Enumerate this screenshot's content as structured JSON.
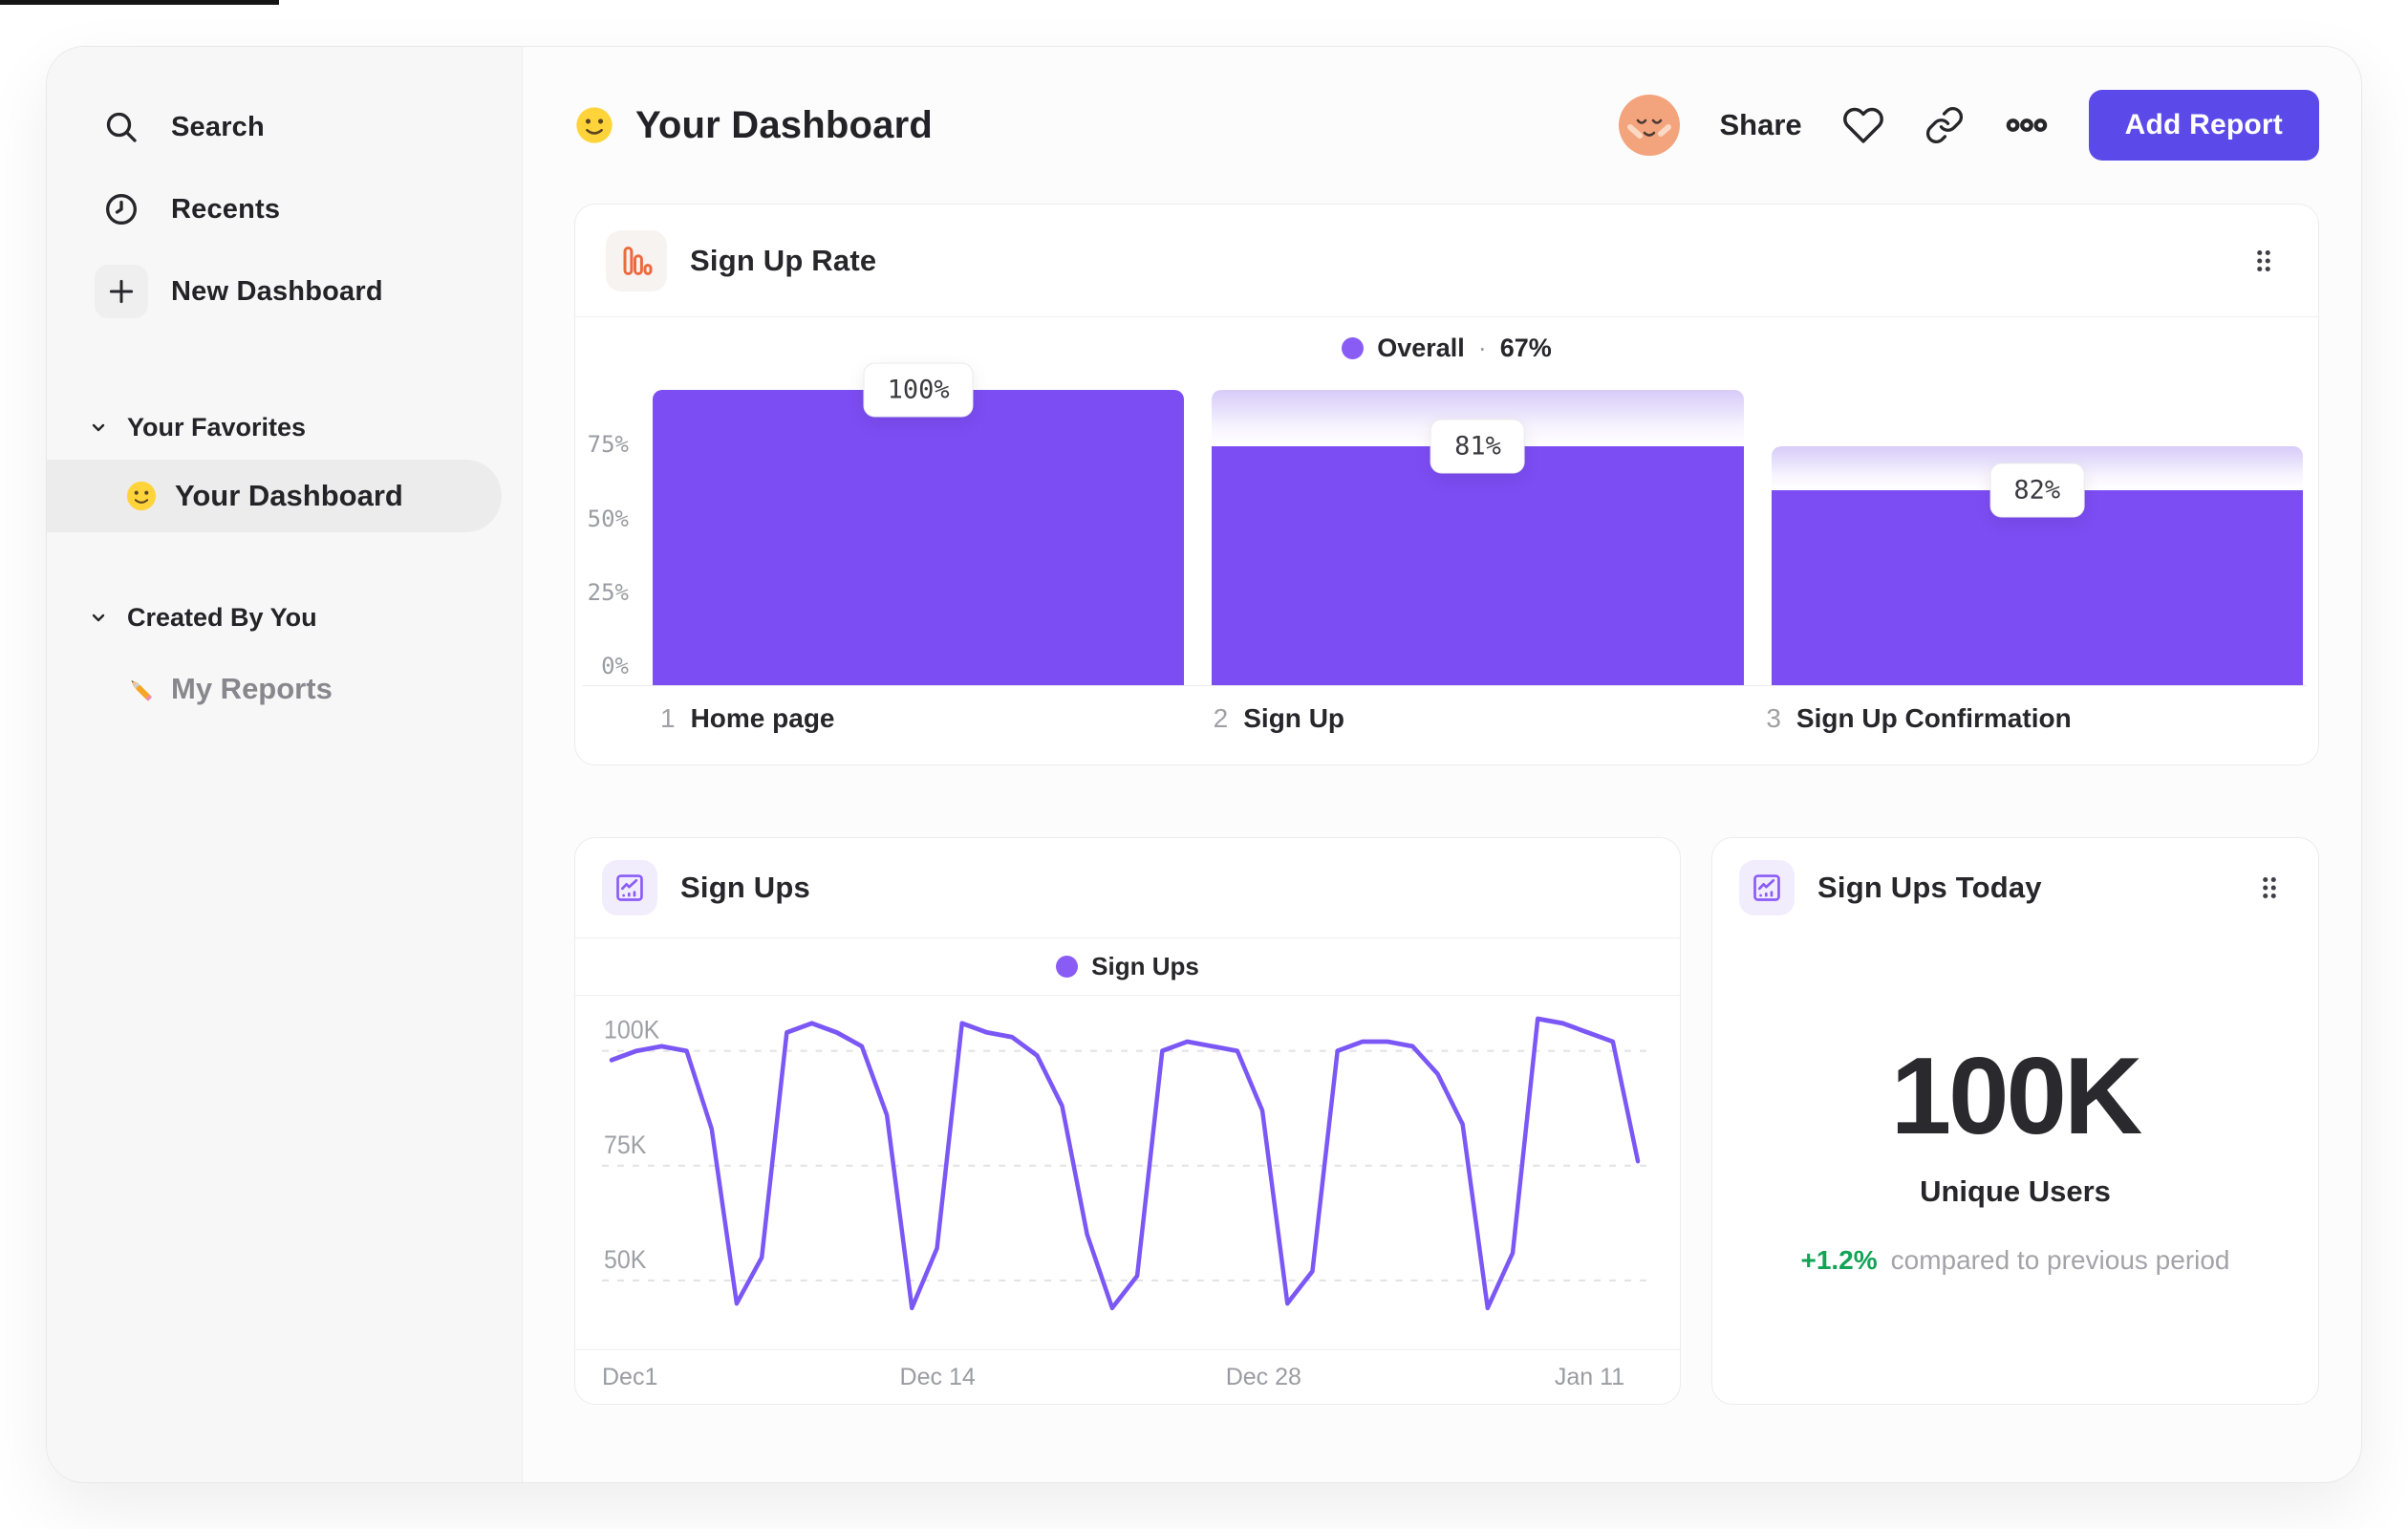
{
  "header": {
    "title": "Your Dashboard",
    "share_label": "Share",
    "add_report_label": "Add Report"
  },
  "sidebar": {
    "nav": [
      {
        "label": "Search"
      },
      {
        "label": "Recents"
      },
      {
        "label": "New Dashboard"
      }
    ],
    "sections": [
      {
        "title": "Your Favorites",
        "items": [
          {
            "label": "Your Dashboard",
            "selected": true
          }
        ]
      },
      {
        "title": "Created By You",
        "items": [
          {
            "label": "My Reports"
          }
        ]
      }
    ]
  },
  "icons": {
    "search-icon": "magnifier",
    "recents-icon": "clock",
    "plus-icon": "plus in rounded square",
    "chevron-down-icon": "small chevron",
    "smiley-emoji-icon": "yellow smiling face",
    "pencil-icon": "pencil emoji",
    "avatar": "peach face with closed eyes",
    "heart-icon": "outline heart",
    "link-icon": "chain link",
    "ellipsis-icon": "three dots",
    "drag-handle-icon": "six dots 2x3",
    "bar-chart-icon": "orange outlined bars",
    "line-chart-icon": "purple framed trend line"
  },
  "colors": {
    "bar_purple": "#7C4DF3",
    "line_purple": "#7B57F6",
    "legend_dot": "#8A5CF6",
    "button_purple": "#5B4AE9",
    "orange": "#ED6A3F",
    "green": "#13A356"
  },
  "chart_data": [
    {
      "type": "bar",
      "variant": "funnel",
      "title": "Sign Up Rate",
      "legend": {
        "label": "Overall",
        "separator": "·",
        "value": "67%"
      },
      "categories": [
        "Home page",
        "Sign Up",
        "Sign Up Confirmation"
      ],
      "step_numbers": [
        "1",
        "2",
        "3"
      ],
      "values_pct_of_total": [
        100,
        81,
        66
      ],
      "step_conversion_labels": [
        "100%",
        "81%",
        "82%"
      ],
      "y_ticks": [
        {
          "label": "0%",
          "pct": 0
        },
        {
          "label": "25%",
          "pct": 25
        },
        {
          "label": "50%",
          "pct": 50
        },
        {
          "label": "75%",
          "pct": 75
        }
      ],
      "ylim": [
        0,
        100
      ],
      "grid": false,
      "legend_position": "top-center",
      "bar_color": "#7C4DF3"
    },
    {
      "type": "line",
      "title": "Sign Ups",
      "legend": {
        "label": "Sign Ups"
      },
      "unit": "K",
      "x_tick_labels": [
        "Dec1",
        "Dec 14",
        "Dec 28",
        "Jan 11"
      ],
      "x_tick_indices": [
        0,
        13,
        26,
        39
      ],
      "y_ticks": [
        {
          "label": "100K",
          "value": 100
        },
        {
          "label": "75K",
          "value": 75
        },
        {
          "label": "50K",
          "value": 50
        }
      ],
      "values": [
        98,
        100,
        101,
        100,
        83,
        45,
        55,
        104,
        106,
        104,
        101,
        86,
        44,
        57,
        106,
        104,
        103,
        99,
        88,
        60,
        44,
        51,
        100,
        102,
        101,
        100,
        87,
        45,
        52,
        100,
        102,
        102,
        101,
        95,
        84,
        44,
        56,
        107,
        106,
        104,
        102,
        76
      ],
      "ylim": [
        35,
        112
      ],
      "grid": "dashed-horizontal",
      "legend_position": "top-center",
      "line_color": "#7B57F6"
    },
    {
      "type": "stat",
      "title": "Sign Ups Today",
      "value": "100K",
      "label": "Unique Users",
      "delta": "+1.2%",
      "delta_context": "compared to previous period"
    }
  ]
}
